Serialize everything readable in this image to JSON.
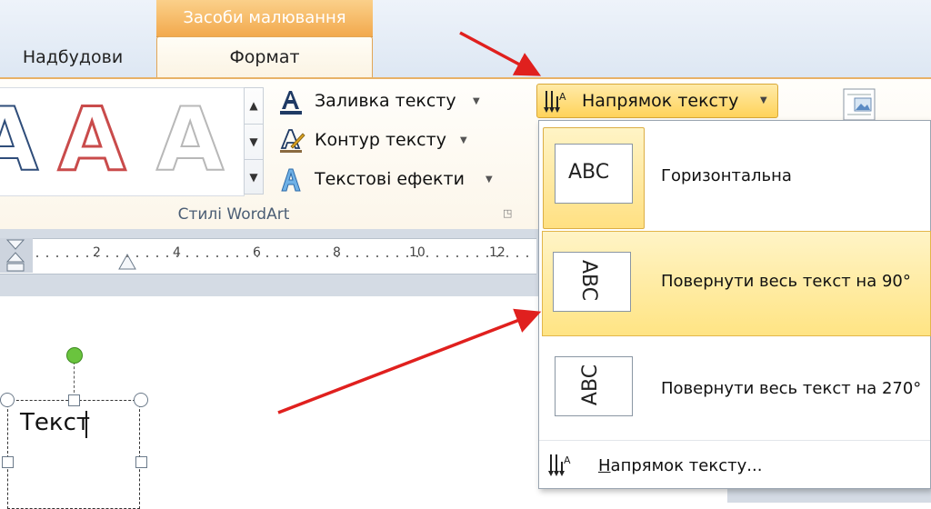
{
  "tabs": {
    "context_group": "Засоби малювання",
    "addins": "Надбудови",
    "format": "Формат"
  },
  "wordart": {
    "gallery_letter": "A",
    "commands": {
      "text_fill": "Заливка тексту",
      "text_outline": "Контур тексту",
      "text_effects": "Текстові ефекти"
    },
    "group_label": "Стилі WordArt"
  },
  "text_direction": {
    "button_label": "Напрямок тексту",
    "options": [
      {
        "label": "Горизонтальна",
        "preview": "ABC"
      },
      {
        "label": "Повернути весь текст на 90°",
        "preview": "ABC"
      },
      {
        "label": "Повернути весь текст на 270°",
        "preview": "ABC"
      }
    ],
    "footer_accel": "Н",
    "footer_rest": "апрямок тексту..."
  },
  "ruler": {
    "numbers": [
      "2",
      "4",
      "6",
      "8",
      "10",
      "12"
    ]
  },
  "document": {
    "textbox_text": "Текст"
  },
  "colors": {
    "context_tab": "#f2a94d",
    "highlight": "#ffe484",
    "annotation_arrow": "#e0201e",
    "rotation_handle": "#6ac43e"
  }
}
